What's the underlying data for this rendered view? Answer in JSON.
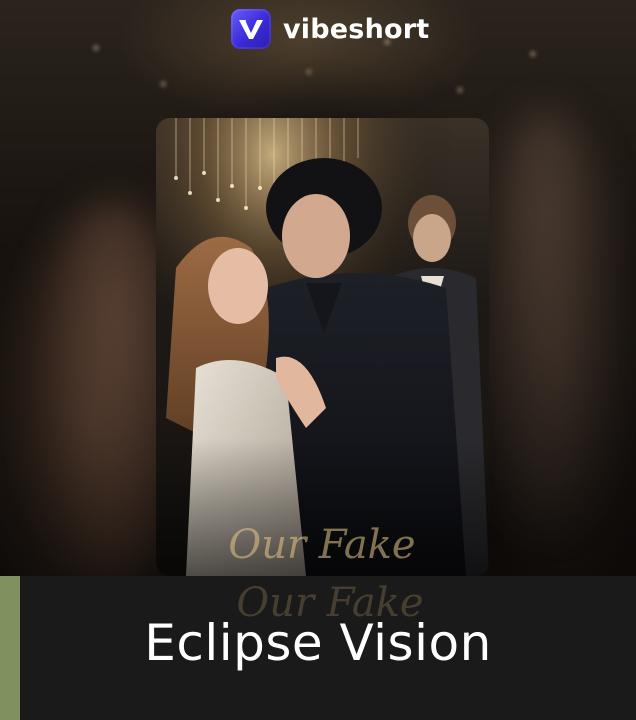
{
  "app": {
    "brand_name": "vibeshort",
    "brand_logo_icon": "vibeshort-logo-icon",
    "accent_color": "#4b3cf0"
  },
  "poster": {
    "artwork": "drama-poster-image",
    "title_script": "Our Fake"
  },
  "caption": {
    "text": "Eclipse Vision",
    "accent_color": "#7e915e"
  }
}
